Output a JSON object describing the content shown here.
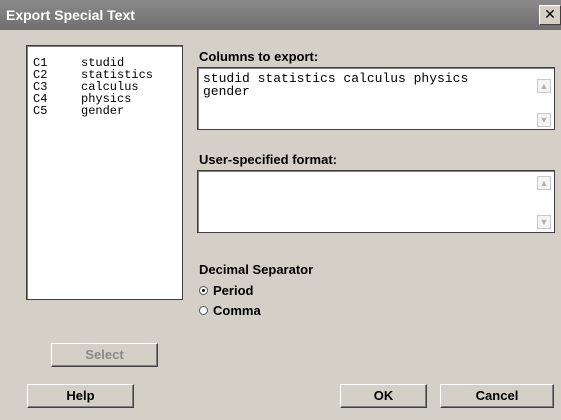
{
  "window": {
    "title": "Export Special Text",
    "close_glyph": "✕"
  },
  "columns_list": [
    {
      "id": "C1",
      "name": "studid"
    },
    {
      "id": "C2",
      "name": "statistics"
    },
    {
      "id": "C3",
      "name": "calculus"
    },
    {
      "id": "C4",
      "name": "physics"
    },
    {
      "id": "C5",
      "name": "gender"
    }
  ],
  "columns_to_export": {
    "label": "Columns to export:",
    "value": "studid statistics calculus physics\ngender"
  },
  "user_format": {
    "label": "User-specified format:",
    "value": ""
  },
  "decimal_separator": {
    "label": "Decimal Separator",
    "options": [
      {
        "label": "Period",
        "checked": true
      },
      {
        "label": "Comma",
        "checked": false
      }
    ]
  },
  "buttons": {
    "select": "Select",
    "help": "Help",
    "ok": "OK",
    "cancel": "Cancel"
  },
  "icons": {
    "scroll_up": "▲",
    "scroll_down": "▼"
  }
}
